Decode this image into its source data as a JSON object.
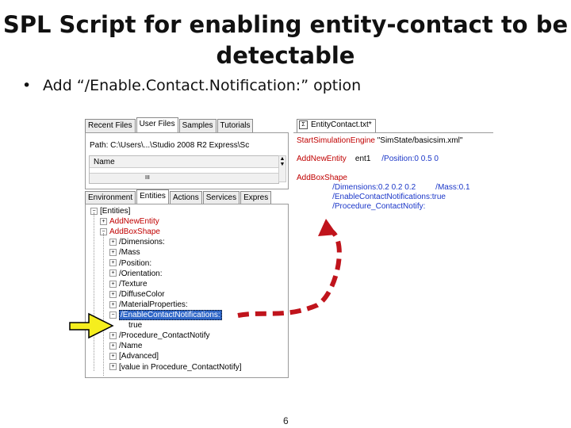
{
  "slide": {
    "title_line1": "SPL Script for enabling entity-contact to be",
    "title_line2": "detectable",
    "bullet_marker": "•",
    "bullet": "Add “/Enable.Contact.Notification:” option",
    "page_number": "6"
  },
  "left_pane": {
    "top_tabs": [
      "Recent Files",
      "User Files",
      "Samples",
      "Tutorials"
    ],
    "path_text": "Path: C:\\Users\\...\\Studio 2008 R2 Express\\Sc",
    "name_header": "Name",
    "scroll_mark": "III",
    "bottom_tabs": [
      "Environment",
      "Entities",
      "Actions",
      "Services",
      "Expres"
    ],
    "tree": [
      {
        "label": "[Entities]",
        "exp": "−",
        "style": "plain"
      },
      {
        "label": "AddNewEntity",
        "exp": "+",
        "style": "red"
      },
      {
        "label": "AddBoxShape",
        "exp": "−",
        "style": "red"
      },
      {
        "label": "/Dimensions:",
        "exp": "+",
        "style": "plain"
      },
      {
        "label": "/Mass",
        "exp": "+",
        "style": "plain"
      },
      {
        "label": "/Position:",
        "exp": "+",
        "style": "plain"
      },
      {
        "label": "/Orientation:",
        "exp": "+",
        "style": "plain"
      },
      {
        "label": "/Texture",
        "exp": "+",
        "style": "plain"
      },
      {
        "label": "/DiffuseColor",
        "exp": "+",
        "style": "plain"
      },
      {
        "label": "/MaterialProperties:",
        "exp": "+",
        "style": "plain"
      },
      {
        "label": "/EnableContactNotifications:",
        "exp": "−",
        "style": "sel"
      },
      {
        "label": "true",
        "exp": "",
        "style": "plain"
      },
      {
        "label": "/Procedure_ContactNotify",
        "exp": "+",
        "style": "plain"
      },
      {
        "label": "/Name",
        "exp": "+",
        "style": "plain"
      },
      {
        "label": "[Advanced]",
        "exp": "+",
        "style": "plain"
      },
      {
        "label": "[value in Procedure_ContactNotify]",
        "exp": "+",
        "style": "plain"
      }
    ]
  },
  "right_pane": {
    "tab_icon": "spl-file-icon",
    "tab_label": "EntityContact.txt*",
    "code": [
      {
        "segments": [
          {
            "text": "StartSimulationEngine",
            "color": "red"
          },
          {
            "text": " \"SimState/basicsim.xml\"",
            "color": "blk"
          }
        ]
      },
      {
        "segments": [
          {
            "text": "AddNewEntity",
            "color": "red"
          },
          {
            "text": "    ent1",
            "color": "blk"
          },
          {
            "text": "     /Position:0 0.5 0",
            "color": "blue"
          }
        ]
      },
      {
        "segments": [
          {
            "text": "AddBoxShape",
            "color": "red"
          }
        ]
      },
      {
        "segments": [
          {
            "text": "    /Dimensions:0.2 0.2 0.2",
            "color": "blue"
          },
          {
            "text": "         /Mass:0.1",
            "color": "blue"
          }
        ]
      },
      {
        "segments": [
          {
            "text": "    /EnableContactNotifications:true",
            "color": "blue"
          }
        ]
      },
      {
        "segments": [
          {
            "text": "    /Procedure_ContactNotify:",
            "color": "blue"
          }
        ]
      }
    ]
  },
  "annotations": {
    "yellow_arrow_color": "#f5ee1e",
    "red_arrow_color": "#c0141c"
  }
}
